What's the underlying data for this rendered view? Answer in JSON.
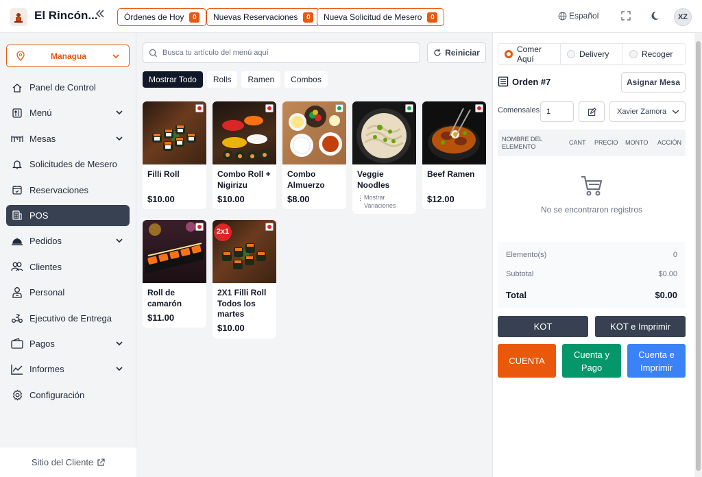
{
  "app": {
    "name": "El Rincón..."
  },
  "header": {
    "orders_today": {
      "label": "Órdenes de Hoy",
      "count": "0"
    },
    "new_reservations": {
      "label": "Nuevas Reservaciones",
      "count": "0"
    },
    "waiter_requests": {
      "label": "Nueva Solicitud de Mesero",
      "count": "0"
    },
    "language": "Español",
    "user_initials": "XZ"
  },
  "sidebar": {
    "branch": "Managua",
    "items": [
      {
        "label": "Panel de Control",
        "icon": "home-icon",
        "expandable": false
      },
      {
        "label": "Menú",
        "icon": "menu-book-icon",
        "expandable": true
      },
      {
        "label": "Mesas",
        "icon": "table-icon",
        "expandable": true
      },
      {
        "label": "Solicitudes de Mesero",
        "icon": "bell-icon",
        "expandable": false
      },
      {
        "label": "Reservaciones",
        "icon": "calendar-icon",
        "expandable": false
      },
      {
        "label": "POS",
        "icon": "pos-icon",
        "expandable": false,
        "active": true
      },
      {
        "label": "Pedidos",
        "icon": "cloche-icon",
        "expandable": true
      },
      {
        "label": "Clientes",
        "icon": "customers-icon",
        "expandable": false
      },
      {
        "label": "Personal",
        "icon": "staff-icon",
        "expandable": false
      },
      {
        "label": "Ejecutivo de Entrega",
        "icon": "delivery-icon",
        "expandable": false
      },
      {
        "label": "Pagos",
        "icon": "wallet-icon",
        "expandable": true
      },
      {
        "label": "Informes",
        "icon": "chart-icon",
        "expandable": true
      },
      {
        "label": "Configuración",
        "icon": "settings-icon",
        "expandable": false
      }
    ],
    "client_site": "Sitio del Cliente"
  },
  "pos": {
    "search_placeholder": "Busca tu artículo del menú aquí",
    "reset_label": "Reiniciar",
    "categories": [
      "Mostrar Todo",
      "Rolls",
      "Ramen",
      "Combos"
    ],
    "items": [
      {
        "name": "Filli Roll",
        "price": "$10.00",
        "type": "nonveg"
      },
      {
        "name": "Combo Roll + Nigirizu",
        "price": "$10.00",
        "type": "nonveg"
      },
      {
        "name": "Combo Almuerzo",
        "price": "$8.00",
        "type": "veg"
      },
      {
        "name": "Veggie Noodles",
        "variations": "Mostrar Variaciones",
        "type": "veg"
      },
      {
        "name": "Beef Ramen",
        "price": "$12.00",
        "type": "nonveg"
      },
      {
        "name": "Roll de camarón",
        "price": "$11.00",
        "type": "nonveg"
      },
      {
        "name": "2X1 Filli Roll Todos los martes",
        "price": "$10.00",
        "type": "nonveg",
        "promo": "2x1"
      }
    ]
  },
  "order": {
    "types": [
      "Comer Aquí",
      "Delivery",
      "Recoger"
    ],
    "title": "Orden #7",
    "assign_table": "Asignar Mesa",
    "guests_label": "Comensales",
    "guests_value": "1",
    "waiter": "Xavier Zamora",
    "columns": [
      "Nombre del Elemento",
      "Cant",
      "Precio",
      "Monto",
      "Acción"
    ],
    "empty_message": "No se encontraron registros",
    "items_label": "Elemento(s)",
    "items_count": "0",
    "subtotal_label": "Subtotal",
    "subtotal": "$0.00",
    "total_label": "Total",
    "total": "$0.00",
    "buttons": {
      "kot": "KOT",
      "kot_print": "KOT e Imprimir",
      "bill": "CUENTA",
      "bill_pay": "Cuenta y Pago",
      "bill_print": "Cuenta e Imprimir"
    }
  },
  "colors": {
    "accent": "#ea580c",
    "dark": "#374151",
    "green": "#059669",
    "blue": "#3b82f6",
    "veg": "#16a34a",
    "nonveg": "#dc2626"
  }
}
